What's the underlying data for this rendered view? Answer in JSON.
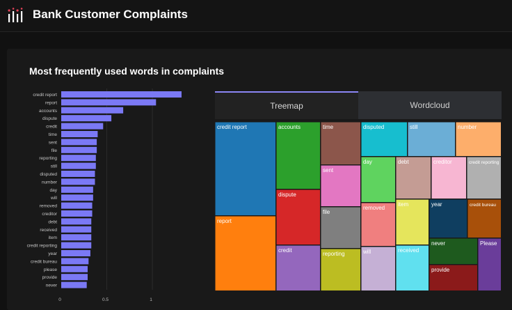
{
  "header": {
    "title": "Bank Customer Complaints",
    "logo_icon": "bars-logo-icon"
  },
  "section": {
    "title": "Most frequently used words in complaints"
  },
  "tabs": [
    {
      "label": "Treemap",
      "active": true
    },
    {
      "label": "Wordcloud",
      "active": false
    }
  ],
  "colors": {
    "bar": "#7b79f5",
    "tab_accent": "#8c86f5",
    "background": "#111111"
  },
  "chart_data": [
    {
      "type": "bar",
      "orientation": "horizontal",
      "categories": [
        "credit report",
        "report",
        "accounts",
        "dispute",
        "credit",
        "time",
        "sent",
        "file",
        "reporting",
        "still",
        "disputed",
        "number",
        "day",
        "will",
        "removed",
        "creditor",
        "debt",
        "received",
        "item",
        "credit reporting",
        "year",
        "credit bureau",
        "please",
        "provide",
        "never"
      ],
      "values": [
        1.32,
        1.04,
        0.68,
        0.55,
        0.46,
        0.4,
        0.39,
        0.39,
        0.38,
        0.38,
        0.37,
        0.37,
        0.35,
        0.35,
        0.34,
        0.34,
        0.33,
        0.33,
        0.33,
        0.33,
        0.32,
        0.3,
        0.29,
        0.29,
        0.28
      ],
      "xlim": [
        0,
        1.45
      ],
      "xticks": [
        "0",
        "0.5",
        "1"
      ],
      "grid": true
    },
    {
      "type": "treemap",
      "items": [
        {
          "label": "credit report",
          "color": "#1f77b4"
        },
        {
          "label": "report",
          "color": "#ff7f0e"
        },
        {
          "label": "accounts",
          "color": "#2ca02c"
        },
        {
          "label": "dispute",
          "color": "#d62728"
        },
        {
          "label": "credit",
          "color": "#9467bd"
        },
        {
          "label": "time",
          "color": "#8c564b"
        },
        {
          "label": "sent",
          "color": "#e377c2"
        },
        {
          "label": "file",
          "color": "#7f7f7f"
        },
        {
          "label": "reporting",
          "color": "#bcbd22"
        },
        {
          "label": "disputed",
          "color": "#17becf"
        },
        {
          "label": "still",
          "color": "#6baed6"
        },
        {
          "label": "number",
          "color": "#fdae6b"
        },
        {
          "label": "day",
          "color": "#5fd35f"
        },
        {
          "label": "debt",
          "color": "#c49c94"
        },
        {
          "label": "creditor",
          "color": "#f7b6d2"
        },
        {
          "label": "credit reporting",
          "color": "#b0b0b0"
        },
        {
          "label": "removed",
          "color": "#f07f7f"
        },
        {
          "label": "item",
          "color": "#e5e55c"
        },
        {
          "label": "year",
          "color": "#0f3e60"
        },
        {
          "label": "credit bureau",
          "color": "#a8500a"
        },
        {
          "label": "will",
          "color": "#c5b0d5"
        },
        {
          "label": "received",
          "color": "#60e0ef"
        },
        {
          "label": "never",
          "color": "#1e5a1e"
        },
        {
          "label": "Please",
          "color": "#6a3d9a"
        },
        {
          "label": "provide",
          "color": "#8b1a1a"
        }
      ]
    }
  ]
}
